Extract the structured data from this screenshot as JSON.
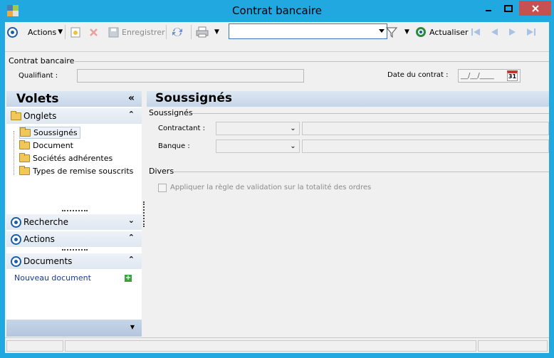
{
  "window": {
    "title": "Contrat bancaire"
  },
  "toolbar": {
    "actions_label": "Actions",
    "enregistrer_label": "Enregistrer",
    "actualiser_label": "Actualiser",
    "search_value": ""
  },
  "header": {
    "group_title": "Contrat bancaire",
    "qualifiant_label": "Qualifiant :",
    "qualifiant_value": "",
    "date_label": "Date du contrat :",
    "date_value": "__/__/____",
    "calendar_day": "31"
  },
  "volets": {
    "title": "Volets",
    "onglets_label": "Onglets",
    "tree": [
      "Soussignés",
      "Document",
      "Sociétés adhérentes",
      "Types de remise souscrits"
    ],
    "recherche_label": "Recherche",
    "actions_label": "Actions",
    "documents_label": "Documents",
    "nouveau_document_label": "Nouveau document"
  },
  "main": {
    "title": "Soussignés",
    "soussignes_group": "Soussignés",
    "contractant_label": "Contractant :",
    "banque_label": "Banque :",
    "divers_group": "Divers",
    "checkbox_label": "Appliquer la règle de validation sur la totalité des ordres"
  },
  "colors": {
    "accent": "#22a8e0",
    "close": "#c75050",
    "panel_header": "#c6d5e8"
  }
}
